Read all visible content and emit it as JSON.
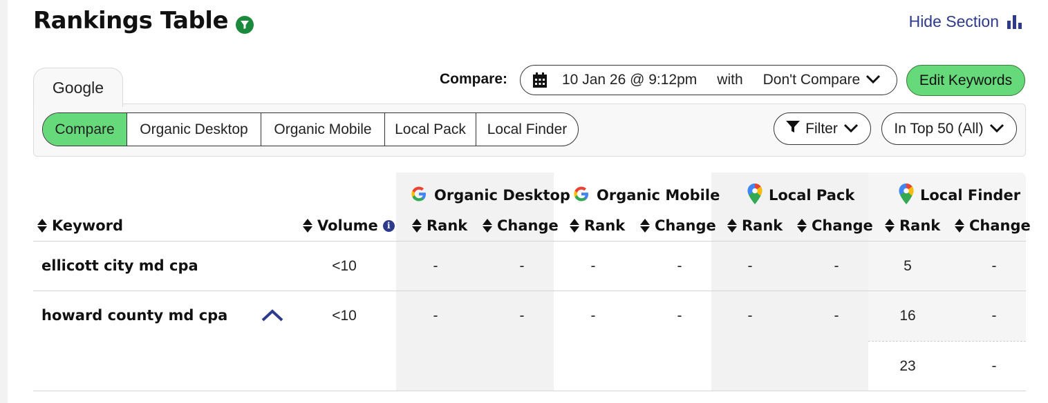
{
  "header": {
    "title": "Rankings Table",
    "hide_section_label": "Hide Section"
  },
  "tabs": [
    "Google"
  ],
  "toolbar": {
    "compare_label": "Compare:",
    "compare_date": "10 Jan 26 @ 9:12pm",
    "compare_with": "with",
    "compare_target": "Don't Compare",
    "edit_keywords_label": "Edit Keywords",
    "filter_label": "Filter",
    "top_range_label": "In Top 50 (All)"
  },
  "view_tabs": [
    {
      "label": "Compare",
      "active": true
    },
    {
      "label": "Organic Desktop",
      "active": false
    },
    {
      "label": "Organic Mobile",
      "active": false
    },
    {
      "label": "Local Pack",
      "active": false
    },
    {
      "label": "Local Finder",
      "active": false
    }
  ],
  "table": {
    "keyword_header": "Keyword",
    "volume_header": "Volume",
    "groups": [
      {
        "name": "Organic Desktop",
        "icon": "google-g-icon"
      },
      {
        "name": "Organic Mobile",
        "icon": "google-g-icon"
      },
      {
        "name": "Local Pack",
        "icon": "google-maps-pin-icon"
      },
      {
        "name": "Local Finder",
        "icon": "google-maps-pin-icon"
      }
    ],
    "sub_headers": {
      "rank": "Rank",
      "change": "Change"
    },
    "rows": [
      {
        "keyword": "ellicott city md cpa",
        "volume": "<10",
        "values": [
          [
            "-",
            "-"
          ],
          [
            "-",
            "-"
          ],
          [
            "-",
            "-"
          ],
          [
            "5",
            "-"
          ]
        ]
      },
      {
        "keyword": "howard county md cpa",
        "volume": "<10",
        "expanded": true,
        "values": [
          [
            "-",
            "-"
          ],
          [
            "-",
            "-"
          ],
          [
            "-",
            "-"
          ],
          [
            "16",
            "-"
          ]
        ],
        "extra_local_finder": [
          "23",
          "-"
        ]
      }
    ]
  },
  "colors": {
    "accent_green": "#66d97a",
    "link_blue": "#2e3a8c",
    "filter_icon_green": "#1c8a3c"
  }
}
